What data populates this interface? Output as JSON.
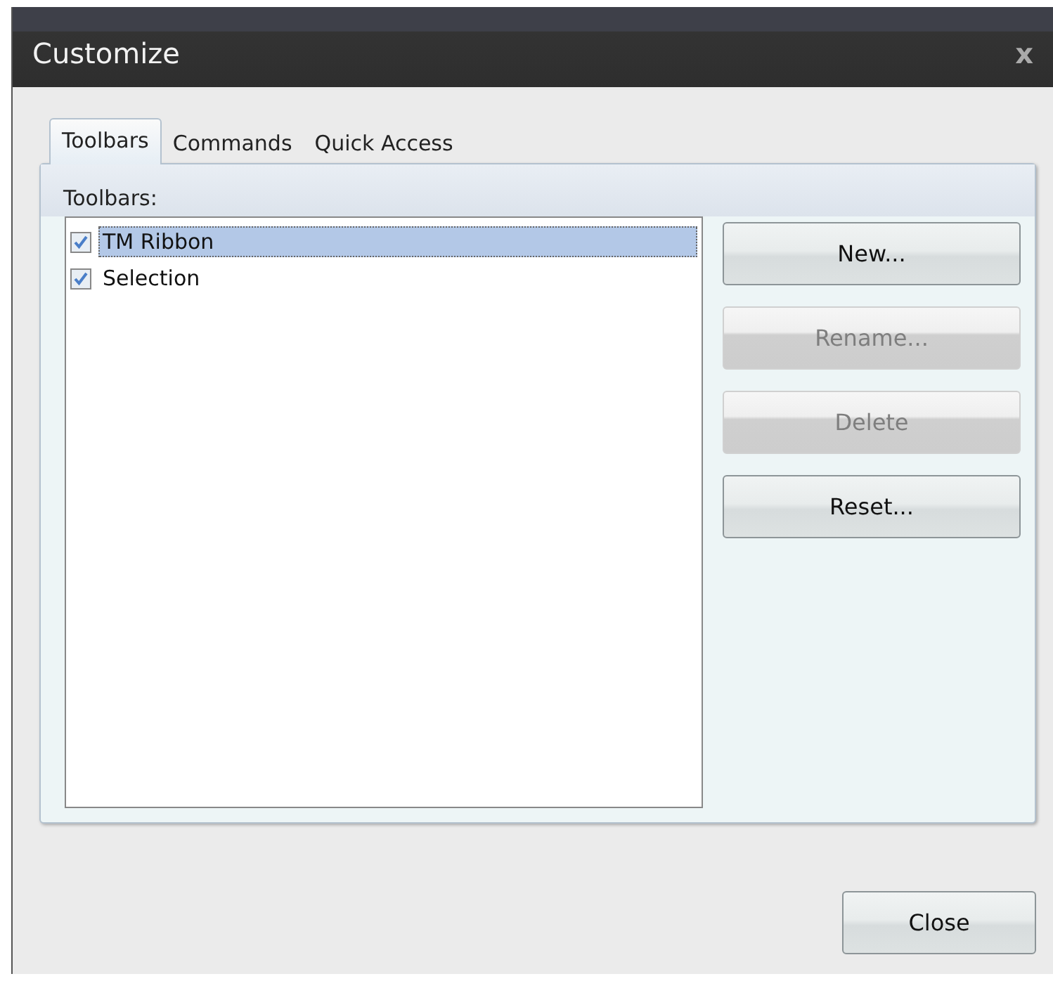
{
  "window": {
    "title": "Customize",
    "close": "x"
  },
  "tabs": [
    {
      "label": "Toolbars",
      "selected": true
    },
    {
      "label": "Commands",
      "selected": false
    },
    {
      "label": "Quick Access",
      "selected": false
    }
  ],
  "toolbars": {
    "label": "Toolbars:",
    "items": [
      {
        "name": "TM Ribbon",
        "checked": true,
        "selected": true
      },
      {
        "name": "Selection",
        "checked": true,
        "selected": false
      }
    ]
  },
  "actions": [
    {
      "label": "New...",
      "disabled": false
    },
    {
      "label": "Rename...",
      "disabled": true
    },
    {
      "label": "Delete",
      "disabled": true
    },
    {
      "label": "Reset...",
      "disabled": false
    }
  ],
  "buttons": [
    "Close"
  ]
}
